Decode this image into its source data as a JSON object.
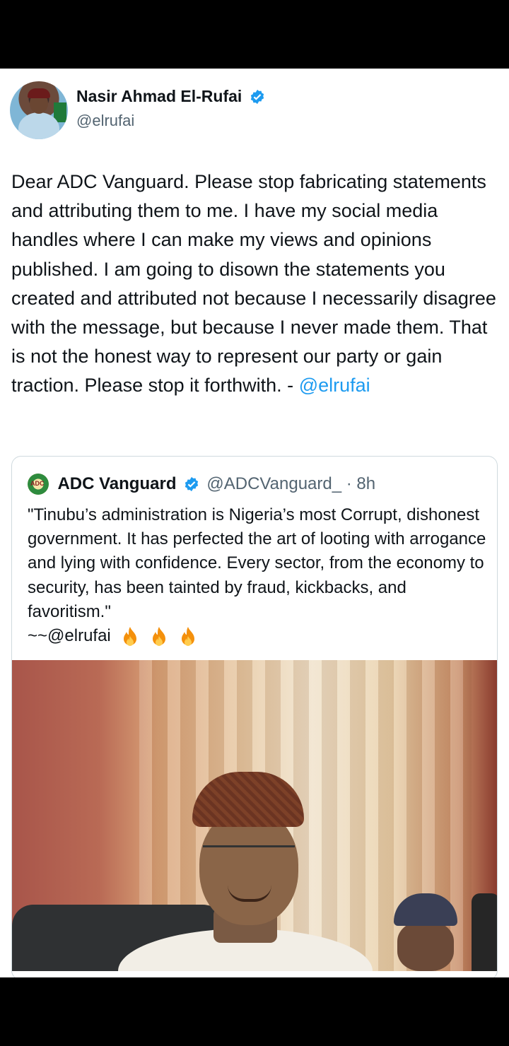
{
  "tweet": {
    "author": {
      "display_name": "Nasir Ahmad El-Rufai",
      "handle": "@elrufai",
      "verified": true,
      "avatar_icon": "profile-photo"
    },
    "text": "Dear ADC Vanguard. Please stop fabricating statements and attributing them to me. I have my social media handles where I can make my views and opinions published. I am going to disown the statements you created and attributed not because I necessarily disagree with the message, but because I never made them. That is not the honest way to represent our party or gain traction. Please stop it forthwith. -",
    "mention": "@elrufai"
  },
  "quoted_tweet": {
    "author": {
      "display_name": "ADC Vanguard",
      "handle_time": "@ADCVanguard_ · 8h",
      "verified": true,
      "logo_text": "ADC"
    },
    "text": "\"Tinubu’s administration is Nigeria’s most Corrupt, dishonest government. It has perfected the art of looting with arrogance and lying with confidence. Every sector, from the economy to security, has been tainted by fraud, kickbacks, and favoritism.\"",
    "tag_line": "~~@elrufai",
    "emoji_icons": [
      "fire-icon",
      "fire-icon",
      "fire-icon"
    ],
    "image_desc_icon": "photo"
  },
  "colors": {
    "link": "#1d9bf0",
    "verified": "#1d9bf0",
    "text": "#0f1419",
    "secondary": "#536471",
    "background_bars": "#000000"
  }
}
